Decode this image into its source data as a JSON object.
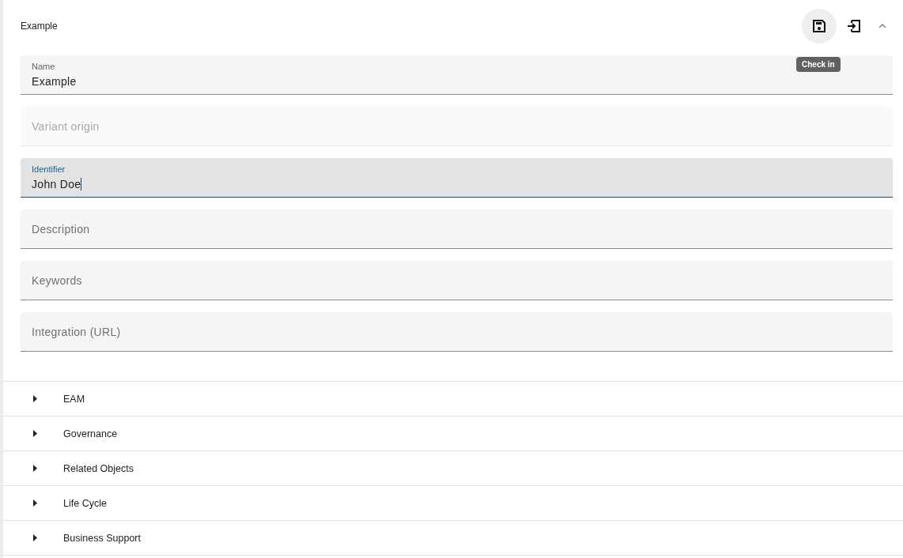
{
  "header": {
    "title": "Example",
    "tooltip": "Check in"
  },
  "fields": [
    {
      "label": "Name",
      "value": "Example",
      "disabled": false,
      "focused": false
    },
    {
      "placeholder": "Variant origin",
      "disabled": true,
      "focused": false
    },
    {
      "label": "Identifier",
      "value": "John Doe",
      "disabled": false,
      "focused": true
    },
    {
      "placeholder": "Description",
      "disabled": false,
      "focused": false
    },
    {
      "placeholder": "Keywords",
      "disabled": false,
      "focused": false
    },
    {
      "placeholder": "Integration (URL)",
      "disabled": false,
      "focused": false
    }
  ],
  "sections": [
    {
      "label": "EAM",
      "expanded": false
    },
    {
      "label": "Governance",
      "expanded": false
    },
    {
      "label": "Related Objects",
      "expanded": false
    },
    {
      "label": "Life Cycle",
      "expanded": false
    },
    {
      "label": "Business Support",
      "expanded": false
    }
  ]
}
